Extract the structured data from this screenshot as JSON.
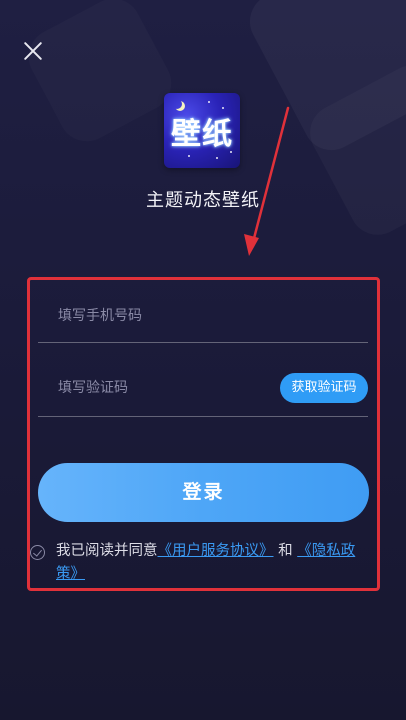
{
  "app": {
    "name": "主题动态壁纸",
    "icon_text": "壁纸"
  },
  "form": {
    "phone_placeholder": "填写手机号码",
    "code_placeholder": "填写验证码",
    "get_code_label": "获取验证码",
    "login_label": "登录"
  },
  "agreement": {
    "prefix": "我已阅读并同意",
    "user_agreement": "《用户服务协议》",
    "conjunction": "和",
    "privacy_policy": "《隐私政策》"
  },
  "colors": {
    "background": "#1c1c3b",
    "accent": "#3a9af3",
    "highlight": "#e0313a"
  }
}
